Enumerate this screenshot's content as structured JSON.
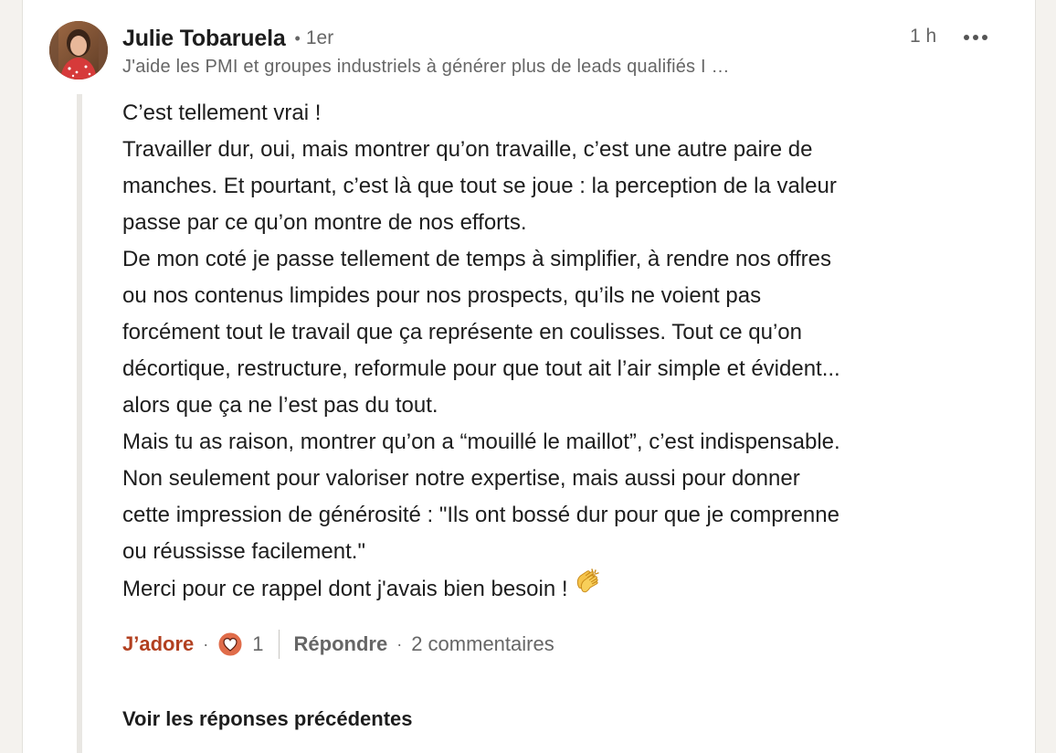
{
  "comment": {
    "author": {
      "name": "Julie Tobaruela",
      "connection_degree": "1er",
      "headline": "J'aide les PMI et groupes industriels à générer plus de leads qualifiés I …",
      "avatar_icon": "avatar-photo"
    },
    "time_ago": "1 h",
    "more_icon": "more-horizontal-icon",
    "body_lines": [
      "C’est tellement vrai !",
      "Travailler dur, oui, mais montrer qu’on travaille, c’est une autre paire de",
      "manches. Et pourtant, c’est là que tout se joue : la perception de la valeur",
      "passe par ce qu’on montre de nos efforts.",
      "De mon coté je passe tellement de temps à simplifier, à rendre nos offres",
      "ou nos contenus limpides pour nos prospects, qu’ils ne voient pas",
      "forcément tout le travail que ça représente en coulisses. Tout ce qu’on",
      "décortique, restructure, reformule pour que tout ait l’air simple et évident...",
      "alors que ça ne l’est pas du tout.",
      "Mais tu as raison, montrer qu’on a “mouillé le maillot”, c’est indispensable.",
      "Non seulement pour valoriser notre expertise, mais aussi pour donner",
      "cette impression de générosité : \"Ils ont bossé dur pour que je comprenne",
      "ou réussisse facilement.\"",
      "Merci pour ce rappel dont j'avais bien besoin !"
    ],
    "trailing_emoji": "clapping-hands-icon",
    "actions": {
      "like_label": "J’adore",
      "reaction_icon": "love-reaction-icon",
      "reaction_count": "1",
      "reply_label": "Répondre",
      "comments_count": "2 commentaires"
    },
    "see_previous_label": "Voir les réponses précédentes"
  },
  "colors": {
    "background": "#f4f2ee",
    "card": "#ffffff",
    "text_primary": "#1d1d1d",
    "text_secondary": "#666666",
    "like_active": "#b24020",
    "reaction_bg": "#e06c4a"
  }
}
